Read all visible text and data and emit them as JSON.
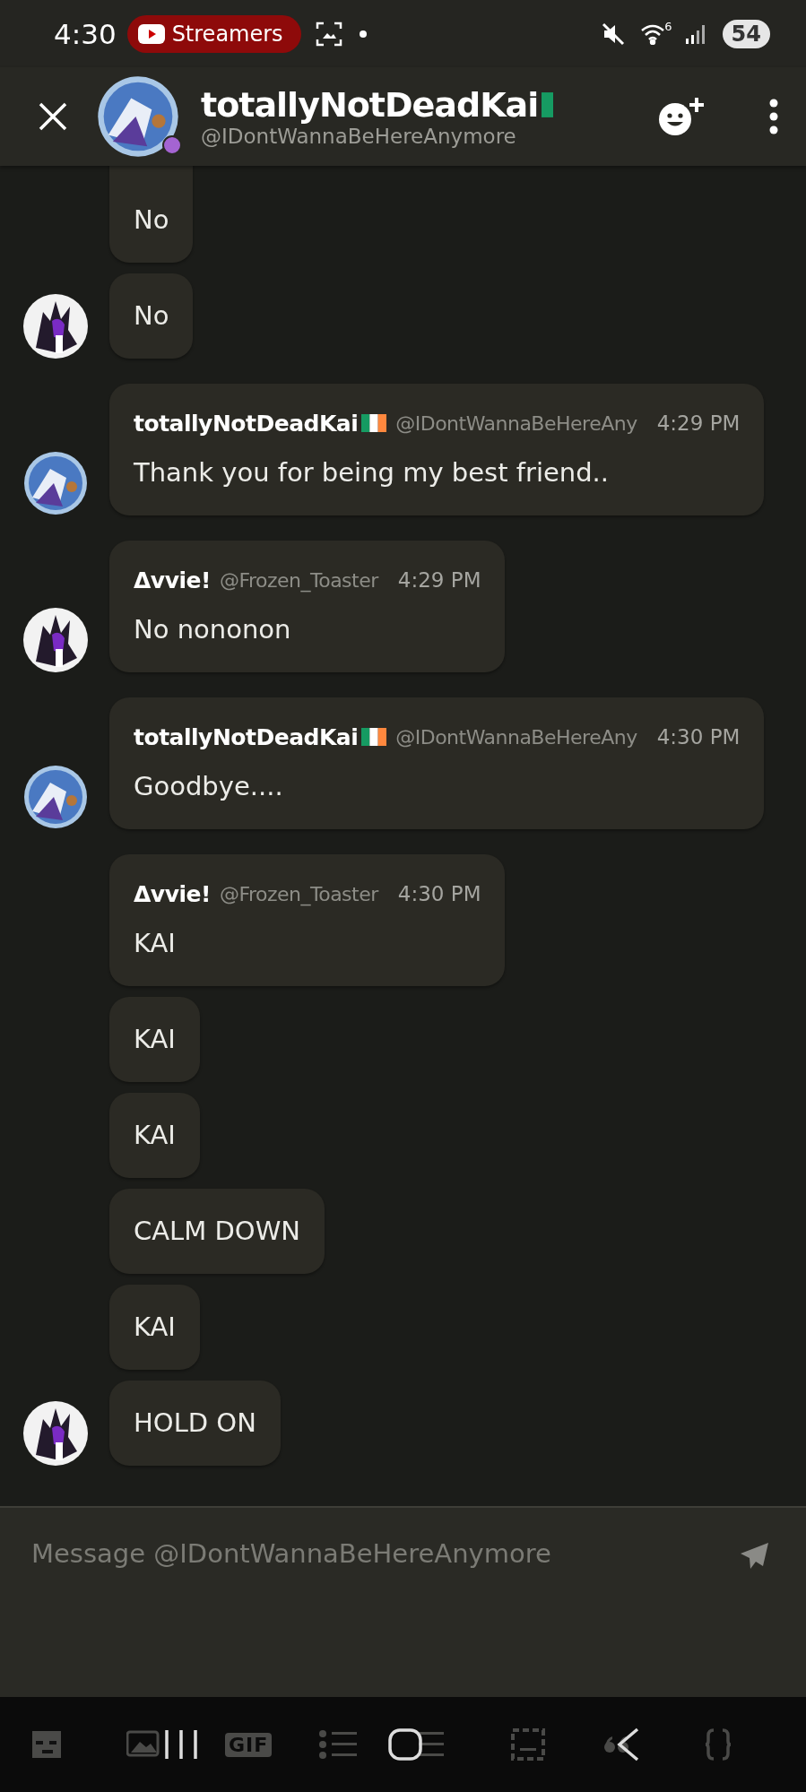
{
  "status_bar": {
    "time": "4:30",
    "media_chip": "Streamers",
    "wifi_band": "6",
    "battery": "54"
  },
  "header": {
    "title": "totallyNotDeadKai",
    "subtitle": "@IDontWannaBeHereAnymore",
    "flag": true,
    "online": true
  },
  "messages": [
    {
      "kind": "cut",
      "text": "No"
    },
    {
      "kind": "avvie",
      "text": "No"
    },
    {
      "kind": "kai",
      "author": "totallyNotDeadKai",
      "flag": true,
      "handle": "@IDontWannaBeHereAny",
      "time": "4:29 PM",
      "text": "Thank you for being my best friend.."
    },
    {
      "kind": "avvie",
      "author": "Δvvie!",
      "flag": false,
      "handle": "@Frozen_Toaster",
      "time": "4:29 PM",
      "text": "No nononon"
    },
    {
      "kind": "kai",
      "author": "totallyNotDeadKai",
      "flag": true,
      "handle": "@IDontWannaBeHereAny",
      "time": "4:30 PM",
      "text": "Goodbye...."
    },
    {
      "kind": "plain",
      "author": "Δvvie!",
      "flag": false,
      "handle": "@Frozen_Toaster",
      "time": "4:30 PM",
      "text": "KAI"
    },
    {
      "kind": "plain",
      "text": "KAI"
    },
    {
      "kind": "plain",
      "text": "KAI"
    },
    {
      "kind": "plain",
      "text": "CALM DOWN"
    },
    {
      "kind": "plain",
      "text": "KAI"
    },
    {
      "kind": "avvie",
      "text": "HOLD ON"
    }
  ],
  "composer": {
    "placeholder": "Message @IDontWannaBeHereAnymore"
  },
  "toolbar": {
    "gif_label": "GIF"
  }
}
